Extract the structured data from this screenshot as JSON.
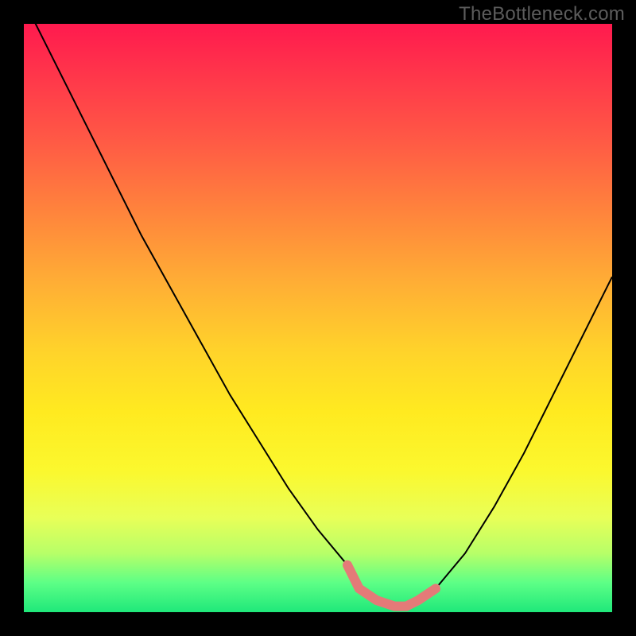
{
  "watermark": "TheBottleneck.com",
  "chart_data": {
    "type": "line",
    "title": "",
    "xlabel": "",
    "ylabel": "",
    "xlim": [
      0,
      100
    ],
    "ylim": [
      0,
      100
    ],
    "series": [
      {
        "name": "bottleneck-curve",
        "x": [
          0,
          5,
          10,
          15,
          20,
          25,
          30,
          35,
          40,
          45,
          50,
          55,
          57,
          60,
          63,
          65,
          67,
          70,
          75,
          80,
          85,
          90,
          95,
          100
        ],
        "y": [
          104,
          94,
          84,
          74,
          64,
          55,
          46,
          37,
          29,
          21,
          14,
          8,
          4,
          2,
          1,
          1,
          2,
          4,
          10,
          18,
          27,
          37,
          47,
          57
        ]
      },
      {
        "name": "basin-highlight",
        "x": [
          55,
          57,
          60,
          63,
          65,
          67,
          70
        ],
        "y": [
          8,
          4,
          2,
          1,
          1,
          2,
          4
        ]
      }
    ],
    "colors": {
      "curve": "#000000",
      "basin": "#e47a78",
      "gradient_top": "#ff1a4e",
      "gradient_bottom": "#1fe87a"
    }
  }
}
